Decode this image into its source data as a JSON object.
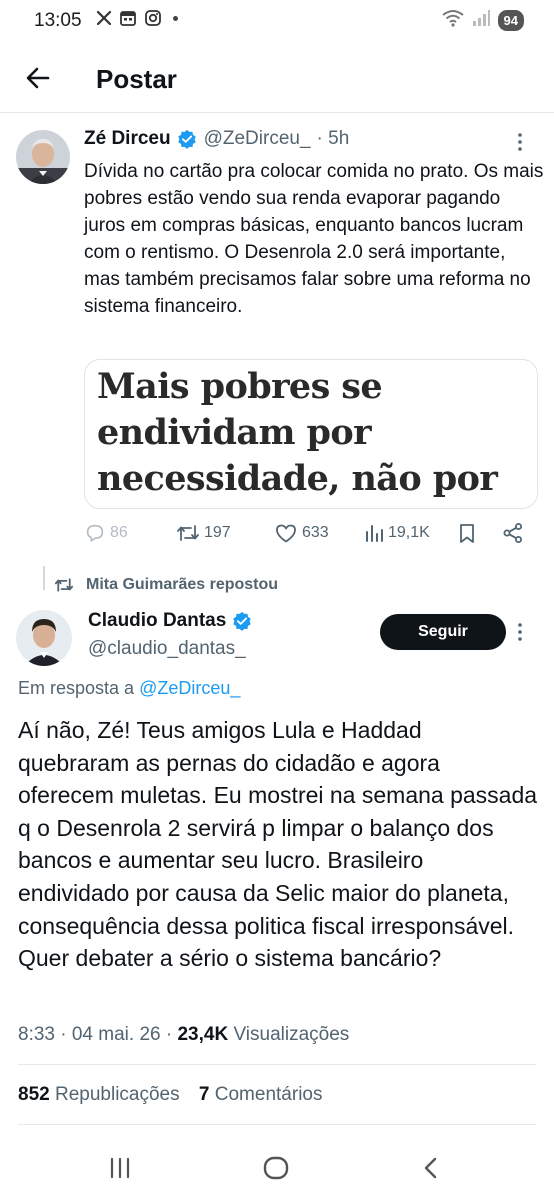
{
  "status_bar": {
    "time": "13:05",
    "battery": "94"
  },
  "header": {
    "title": "Postar"
  },
  "tweet": {
    "name": "Zé Dirceu",
    "handle": "@ZeDirceu_",
    "time": "· 5h",
    "text": "Dívida no cartão pra colocar comida no prato. Os mais pobres estão vendo sua renda evaporar pagando juros em compras básicas, enquanto bancos lucram com o rentismo. O Desenrola 2.0 será importante, mas também precisamos falar sobre uma reforma no sistema financeiro.",
    "card_headline": "Mais pobres se endividam por necessidade, não por consumismo, diz pesquisa",
    "replies": "86",
    "reposts": "197",
    "likes": "633",
    "views": "19,1K"
  },
  "repost_banner": {
    "label": "Mita Guimarães repostou"
  },
  "reply": {
    "name": "Claudio Dantas",
    "handle": "@claudio_dantas_",
    "follow_label": "Seguir",
    "reply_prefix": "Em resposta a",
    "reply_target": "@ZeDirceu_",
    "text": "Aí não,  Zé! Teus amigos Lula e Haddad quebraram as pernas do cidadão e agora oferecem muletas. Eu mostrei na semana passada q o Desenrola 2 servirá p limpar o balanço dos bancos e aumentar seu lucro. Brasileiro endividado por causa da Selic maior do planeta, consequência dessa politica fiscal irresponsável. Quer debater a sério o sistema bancário?",
    "timestamp": "8:33 · 04 mai. 26 ·",
    "views_count": "23,4K",
    "views_label": "Visualizações",
    "reposts_count": "852",
    "reposts_label": "Republicações",
    "comments_count": "7",
    "comments_label": "Comentários"
  },
  "colors": {
    "accent": "#1d9bf0",
    "text": "#0f1419",
    "secondary": "#536471",
    "follow_bg": "#0f1419"
  }
}
